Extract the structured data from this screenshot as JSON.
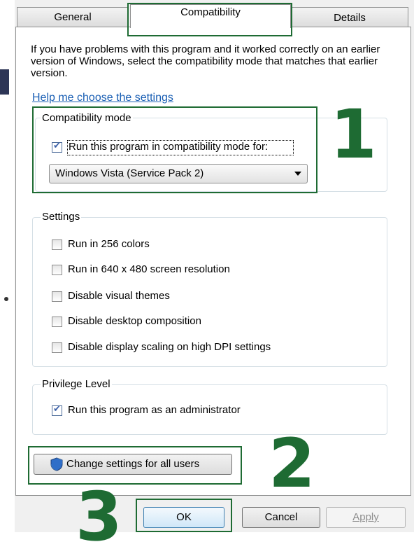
{
  "tabs": {
    "general": "General",
    "compatibility": "Compatibility",
    "details": "Details"
  },
  "intro": "If you have problems with this program and it worked correctly on an earlier version of Windows, select the compatibility mode that matches that earlier version.",
  "help_link": "Help me choose the settings",
  "compatibility_mode": {
    "legend": "Compatibility mode",
    "run_in_compat_label": "Run this program in compatibility mode for:",
    "run_in_compat_checked": true,
    "selected_os": "Windows Vista (Service Pack 2)"
  },
  "settings": {
    "legend": "Settings",
    "items": [
      {
        "label": "Run in 256 colors",
        "checked": false
      },
      {
        "label": "Run in 640 x 480 screen resolution",
        "checked": false
      },
      {
        "label": "Disable visual themes",
        "checked": false
      },
      {
        "label": "Disable desktop composition",
        "checked": false
      },
      {
        "label": "Disable display scaling on high DPI settings",
        "checked": false
      }
    ]
  },
  "privilege": {
    "legend": "Privilege Level",
    "run_as_admin_label": "Run this program as an administrator",
    "run_as_admin_checked": true
  },
  "change_settings_label": "Change settings for all users",
  "buttons": {
    "ok": "OK",
    "cancel": "Cancel",
    "apply": "Apply"
  },
  "annotations": {
    "one": "1",
    "two": "2",
    "three": "3",
    "color": "#1e6b33"
  }
}
